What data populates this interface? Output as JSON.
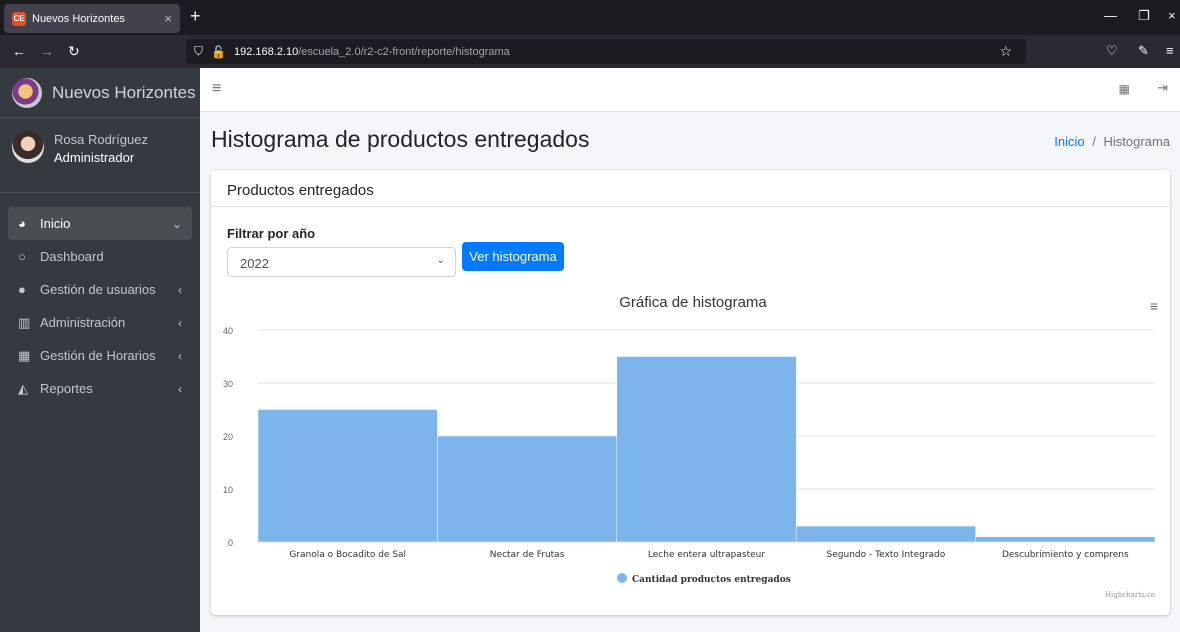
{
  "browser": {
    "tab_title": "Nuevos Horizontes",
    "tab_favicon": "CE",
    "url_host": "192.168.2.10",
    "url_path": "/escuela_2.0/r2-c2-front/reporte/histograma"
  },
  "sidebar": {
    "brand": "Nuevos Horizontes",
    "user_name": "Rosa Rodríguez",
    "user_role": "Administrador",
    "items": [
      {
        "label": "Inicio",
        "icon": "dashboard-gauge-icon",
        "glyph": "🅓",
        "arrow": "⌄",
        "active": true
      },
      {
        "label": "Dashboard",
        "icon": "circle-icon",
        "glyph": "○",
        "arrow": ""
      },
      {
        "label": "Gestión de usuarios",
        "icon": "user-icon",
        "glyph": "👤",
        "arrow": "‹"
      },
      {
        "label": "Administración",
        "icon": "building-icon",
        "glyph": "🏛",
        "arrow": "‹"
      },
      {
        "label": "Gestión de Horarios",
        "icon": "calendar-icon",
        "glyph": "📅",
        "arrow": "‹"
      },
      {
        "label": "Reportes",
        "icon": "chart-icon",
        "glyph": "📈",
        "arrow": "‹"
      }
    ]
  },
  "header": {
    "page_title": "Histograma de productos entregados",
    "breadcrumb_home": "Inicio",
    "breadcrumb_sep": "/",
    "breadcrumb_current": "Histograma"
  },
  "card": {
    "title": "Productos entregados",
    "filter_label": "Filtrar por año",
    "selected_year": "2022",
    "button_label": "Ver histograma"
  },
  "chart_data": {
    "type": "bar",
    "title": "Gráfica de histograma",
    "categories": [
      "Granola o Bocadito de Sal",
      "Nectar de Frutas",
      "Leche entera ultrapasteur",
      "Segundo - Texto Integrado",
      "Descubrimiento y comprens"
    ],
    "series": [
      {
        "name": "Cantidad productos entregados",
        "values": [
          25,
          20,
          35,
          3,
          1
        ]
      }
    ],
    "ylim": [
      0,
      40
    ],
    "yticks": [
      0,
      10,
      20,
      30,
      40
    ],
    "grid": true,
    "legend": "bottom-center",
    "color": "#7cb5ec",
    "credits": "Highcharts.co"
  }
}
